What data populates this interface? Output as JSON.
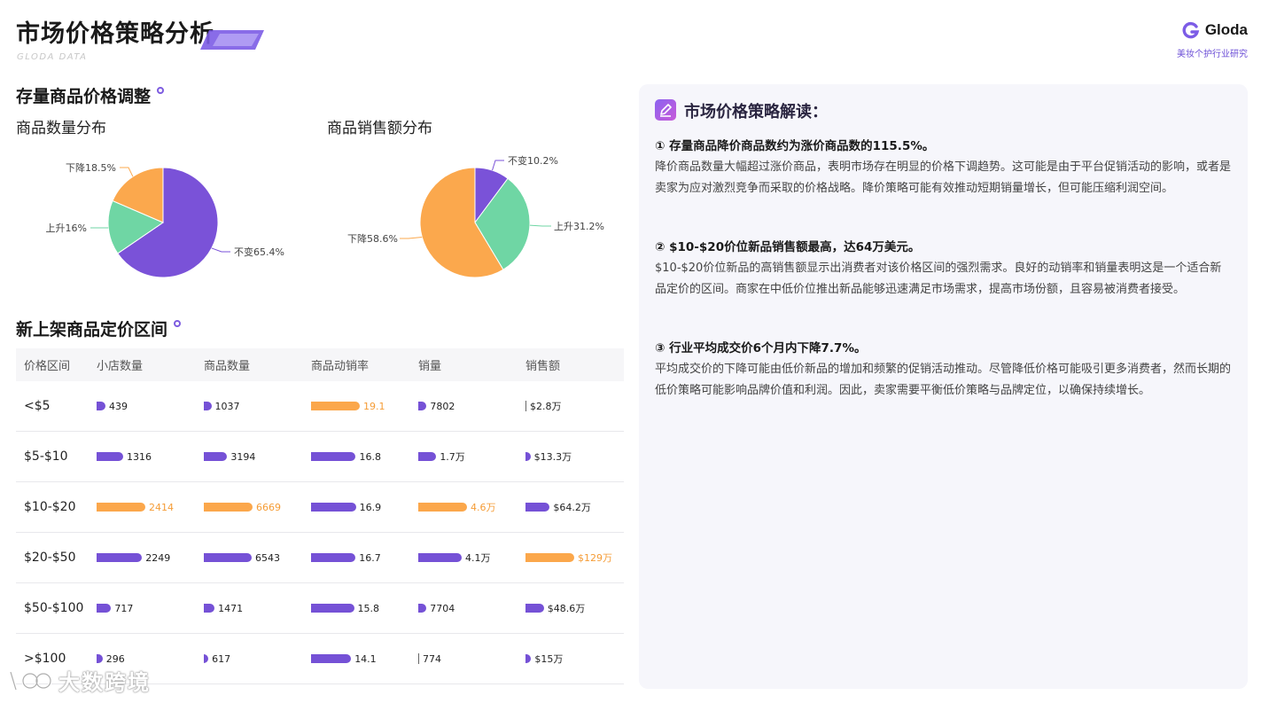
{
  "header": {
    "title": "市场价格策略分析",
    "subtitle": "GLODA DATA",
    "brand_name": "Gloda",
    "brand_tag": "美妆个护行业研究"
  },
  "section1": {
    "title": "存量商品价格调整"
  },
  "section2": {
    "title": "新上架商品定价区间"
  },
  "chart_data": [
    {
      "type": "pie",
      "title": "商品数量分布",
      "slices": [
        {
          "label": "不变65.4%",
          "value": 65.4,
          "color": "#7a52d8"
        },
        {
          "label": "上升16%",
          "value": 16.0,
          "color": "#6fd6a4"
        },
        {
          "label": "下降18.5%",
          "value": 18.5,
          "color": "#fba84d"
        }
      ]
    },
    {
      "type": "pie",
      "title": "商品销售额分布",
      "slices": [
        {
          "label": "不变10.2%",
          "value": 10.2,
          "color": "#7a52d8"
        },
        {
          "label": "上升31.2%",
          "value": 31.2,
          "color": "#6fd6a4"
        },
        {
          "label": "下降58.6%",
          "value": 58.6,
          "color": "#fba84d"
        }
      ]
    },
    {
      "type": "table",
      "columns": [
        "价格区间",
        "小店数量",
        "商品数量",
        "商品动销率",
        "销量",
        "销售额"
      ],
      "rows": [
        {
          "range": "<$5",
          "cells": [
            {
              "label": "439",
              "value": 439,
              "hi": false
            },
            {
              "label": "1037",
              "value": 1037,
              "hi": false
            },
            {
              "label": "19.1",
              "value": 19.1,
              "hi": true
            },
            {
              "label": "7802",
              "value": 7802,
              "hi": false
            },
            {
              "label": "$2.8万",
              "value": 2.8,
              "hi": false
            }
          ]
        },
        {
          "range": "$5-$10",
          "cells": [
            {
              "label": "1316",
              "value": 1316,
              "hi": false
            },
            {
              "label": "3194",
              "value": 3194,
              "hi": false
            },
            {
              "label": "16.8",
              "value": 16.8,
              "hi": false
            },
            {
              "label": "1.7万",
              "value": 17000,
              "hi": false
            },
            {
              "label": "$13.3万",
              "value": 13.3,
              "hi": false
            }
          ]
        },
        {
          "range": "$10-$20",
          "cells": [
            {
              "label": "2414",
              "value": 2414,
              "hi": true
            },
            {
              "label": "6669",
              "value": 6669,
              "hi": true
            },
            {
              "label": "16.9",
              "value": 16.9,
              "hi": false
            },
            {
              "label": "4.6万",
              "value": 46000,
              "hi": true
            },
            {
              "label": "$64.2万",
              "value": 64.2,
              "hi": false
            }
          ]
        },
        {
          "range": "$20-$50",
          "cells": [
            {
              "label": "2249",
              "value": 2249,
              "hi": false
            },
            {
              "label": "6543",
              "value": 6543,
              "hi": false
            },
            {
              "label": "16.7",
              "value": 16.7,
              "hi": false
            },
            {
              "label": "4.1万",
              "value": 41000,
              "hi": false
            },
            {
              "label": "$129万",
              "value": 129,
              "hi": true
            }
          ]
        },
        {
          "range": "$50-$100",
          "cells": [
            {
              "label": "717",
              "value": 717,
              "hi": false
            },
            {
              "label": "1471",
              "value": 1471,
              "hi": false
            },
            {
              "label": "15.8",
              "value": 15.8,
              "hi": false
            },
            {
              "label": "7704",
              "value": 7704,
              "hi": false
            },
            {
              "label": "$48.6万",
              "value": 48.6,
              "hi": false
            }
          ]
        },
        {
          "range": ">$100",
          "cells": [
            {
              "label": "296",
              "value": 296,
              "hi": false
            },
            {
              "label": "617",
              "value": 617,
              "hi": false
            },
            {
              "label": "14.1",
              "value": 14.1,
              "hi": false
            },
            {
              "label": "774",
              "value": 774,
              "hi": false
            },
            {
              "label": "$15万",
              "value": 15,
              "hi": false
            }
          ]
        }
      ]
    }
  ],
  "panel": {
    "title": "市场价格策略解读：",
    "points": [
      {
        "title": "① 存量商品降价商品数约为涨价商品数的115.5%。",
        "body": "降价商品数量大幅超过涨价商品，表明市场存在明显的价格下调趋势。这可能是由于平台促销活动的影响，或者是卖家为应对激烈竞争而采取的价格战略。降价策略可能有效推动短期销量增长，但可能压缩利润空间。"
      },
      {
        "title": "② $10-$20价位新品销售额最高，达64万美元。",
        "body": "$10-$20价位新品的高销售额显示出消费者对该价格区间的强烈需求。良好的动销率和销量表明这是一个适合新品定价的区间。商家在中低价位推出新品能够迅速满足市场需求，提高市场份额，且容易被消费者接受。"
      },
      {
        "title": "③ 行业平均成交价6个月内下降7.7%。",
        "body": "平均成交价的下降可能由低价新品的增加和频繁的促销活动推动。尽管降低价格可能吸引更多消费者，然而长期的低价策略可能影响品牌价值和利润。因此，卖家需要平衡低价策略与品牌定位，以确保持续增长。"
      }
    ]
  },
  "watermark": {
    "text": "大数跨境"
  }
}
